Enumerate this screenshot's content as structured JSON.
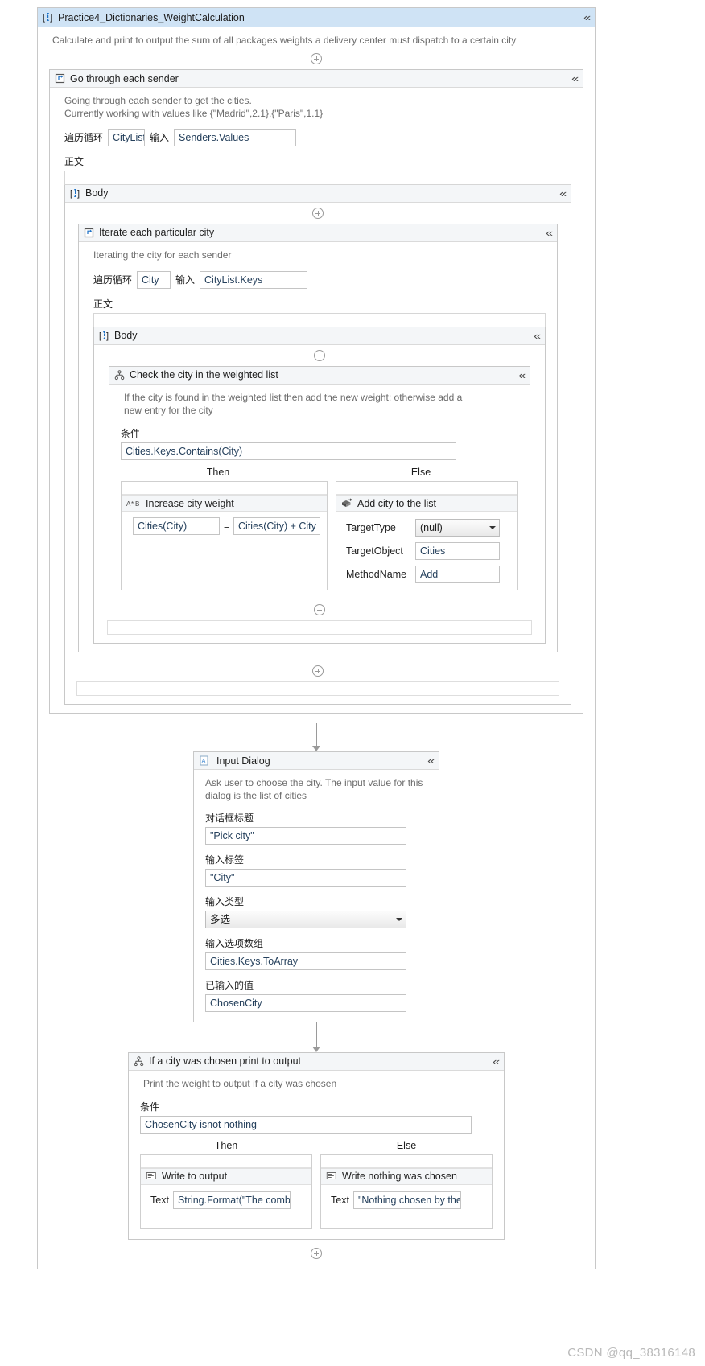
{
  "root": {
    "title": "Practice4_Dictionaries_WeightCalculation",
    "annotation": "Calculate and print to output the sum of all packages weights a delivery center must dispatch to a certain city",
    "icon": "sequence-icon",
    "collapse_glyph": "«"
  },
  "labels": {
    "foreach": "遍历循环",
    "input": "输入",
    "body_cn": "正文",
    "condition": "条件",
    "then": "Then",
    "else": "Else",
    "body": "Body"
  },
  "outer_loop": {
    "title": "Go through each sender",
    "icon": "foreach-icon",
    "annotation_line1": "Going through each sender to get the cities.",
    "annotation_line2": "Currently working with values like {\"Madrid\",2.1},{\"Paris\",1.1}",
    "item_var": "CityList",
    "collection": "Senders.Values"
  },
  "inner_loop": {
    "title": "Iterate each particular city",
    "icon": "foreach-icon",
    "annotation": "Iterating the city for each sender",
    "item_var": "City",
    "collection": "CityList.Keys"
  },
  "if_weighted": {
    "title": "Check the city in the weighted list",
    "icon": "if-icon",
    "annotation": "If the city is found in the weighted list then add the new weight; otherwise add a new entry for the city",
    "condition": "Cities.Keys.Contains(City)",
    "then_activity": {
      "title": "Increase city weight",
      "icon": "assign-icon",
      "icon_text": "A*B",
      "left": "Cities(City)",
      "operator": "=",
      "right": "Cities(City) + City"
    },
    "else_activity": {
      "title": "Add city to the list",
      "icon": "invoke-method-icon",
      "properties": [
        {
          "name": "TargetType",
          "value": "(null)",
          "type": "combo"
        },
        {
          "name": "TargetObject",
          "value": "Cities",
          "type": "text"
        },
        {
          "name": "MethodName",
          "value": "Add",
          "type": "text"
        }
      ]
    }
  },
  "input_dialog": {
    "title": "Input Dialog",
    "icon": "input-dialog-icon",
    "annotation": "Ask user to choose the city. The input value for this dialog is the list of cities",
    "fields": [
      {
        "label": "对话框标题",
        "value": "\"Pick city\"",
        "type": "text"
      },
      {
        "label": "输入标签",
        "value": "\"City\"",
        "type": "text"
      },
      {
        "label": "输入类型",
        "value": "多选",
        "type": "combo"
      },
      {
        "label": "输入选项数组",
        "value": "Cities.Keys.ToArray",
        "type": "text"
      },
      {
        "label": "已输入的值",
        "value": "ChosenCity",
        "type": "text"
      }
    ]
  },
  "if_chosen": {
    "title": "If a city was chosen print to output",
    "icon": "if-icon",
    "annotation": "Print the weight to output if a city was chosen",
    "condition": "ChosenCity isnot nothing",
    "then_activity": {
      "title": "Write to output",
      "icon": "write-line-icon",
      "field_label": "Text",
      "value": "String.Format(\"The combi"
    },
    "else_activity": {
      "title": "Write nothing was chosen",
      "icon": "write-line-icon",
      "field_label": "Text",
      "value": "\"Nothing chosen by the us"
    }
  },
  "watermark": "CSDN @qq_38316148"
}
